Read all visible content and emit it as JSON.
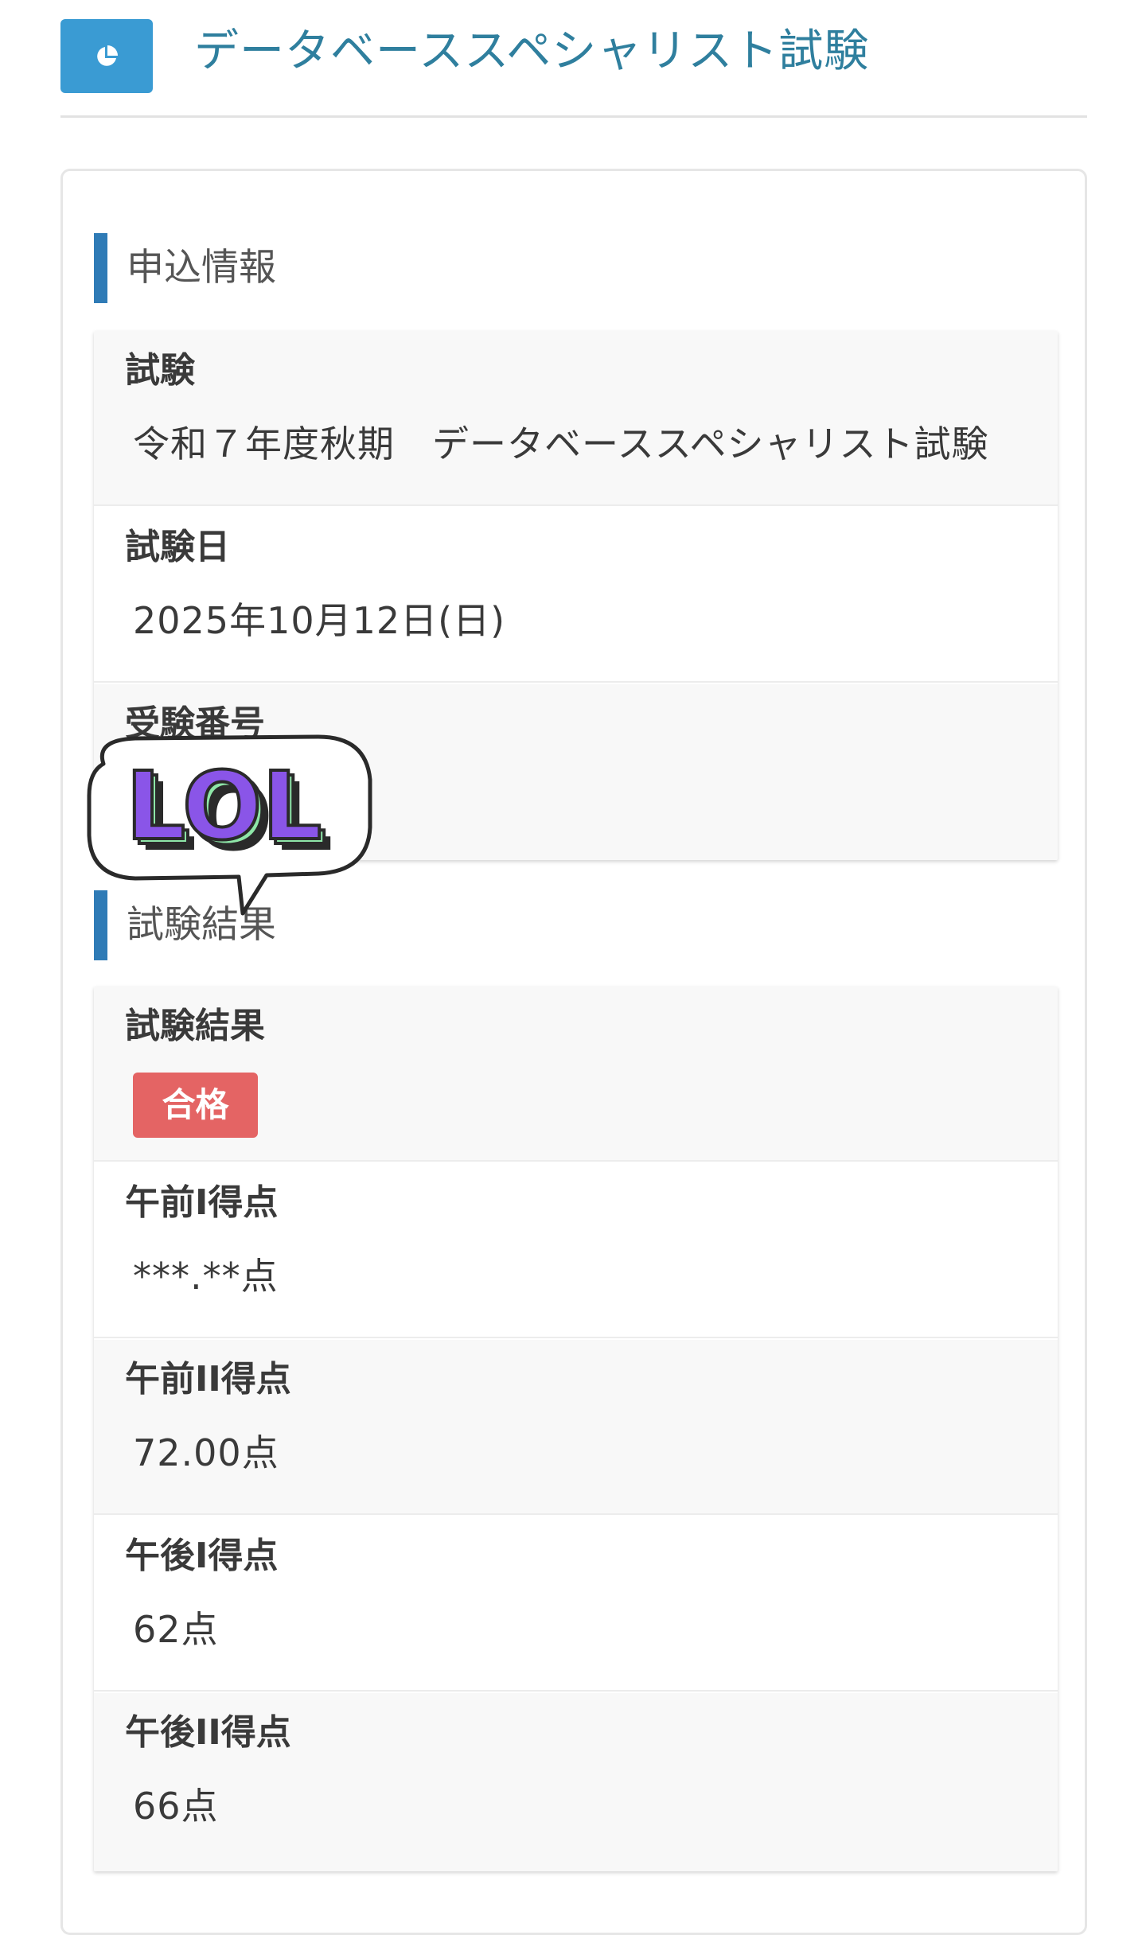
{
  "header": {
    "icon": "pie-chart-icon",
    "title": "データベーススペシャリスト試験"
  },
  "sections": {
    "application": {
      "heading": "申込情報",
      "rows": [
        {
          "label": "試験",
          "value": "令和７年度秋期　データベーススペシャリスト試験"
        },
        {
          "label": "試験日",
          "value": "2025年10月12日(日)"
        },
        {
          "label": "受験番号",
          "value": ""
        }
      ]
    },
    "results": {
      "heading": "試験結果",
      "result_label": "試験結果",
      "result_badge": "合格",
      "badge_color": "#e46464",
      "rows": [
        {
          "label": "午前I得点",
          "value": "***.**点"
        },
        {
          "label": "午前II得点",
          "value": "72.00点"
        },
        {
          "label": "午後I得点",
          "value": "62点"
        },
        {
          "label": "午後II得点",
          "value": "66点"
        }
      ]
    }
  },
  "sticker": {
    "text": "LOL",
    "icon": "lol-speech-bubble-sticker"
  },
  "colors": {
    "accent": "#2f7bb6",
    "header_icon_bg": "#3a9bd3",
    "title": "#2f7f9e"
  }
}
